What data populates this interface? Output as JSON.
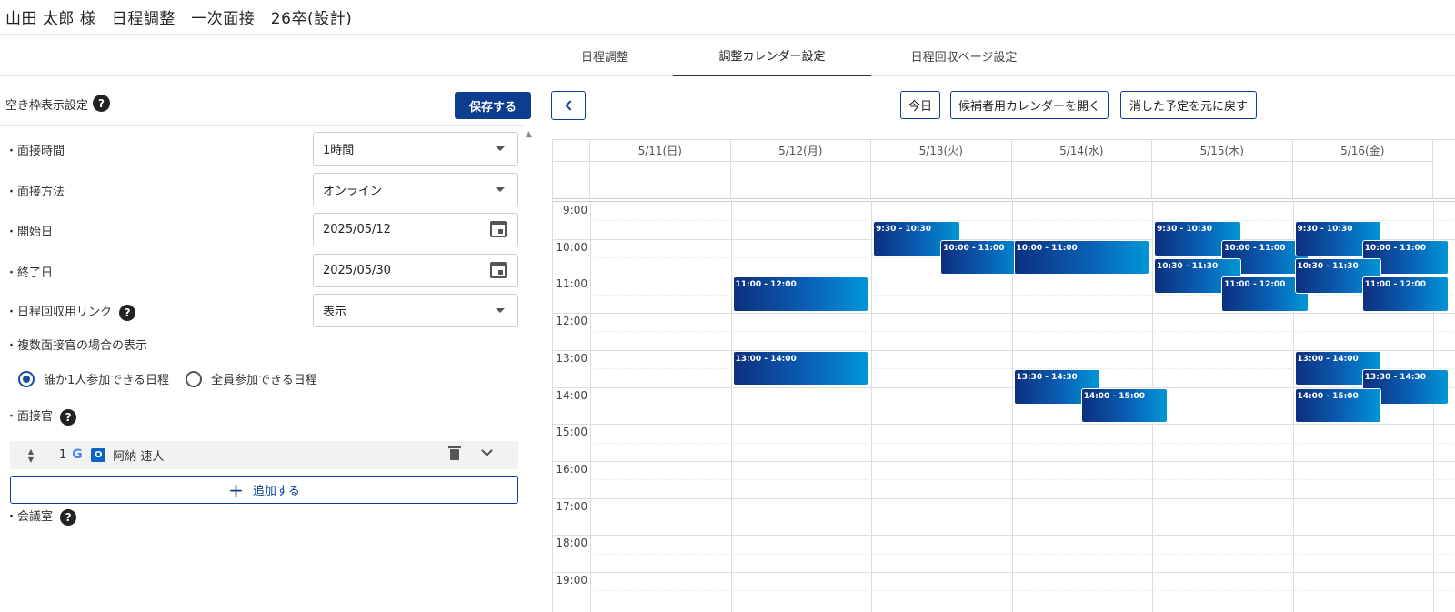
{
  "header": {
    "title": "山田 太郎 様　日程調整　一次面接　26卒(設計)"
  },
  "tabs": [
    {
      "label": "日程調整",
      "active": false
    },
    {
      "label": "調整カレンダー設定",
      "active": true
    },
    {
      "label": "日程回収ページ設定",
      "active": false
    }
  ],
  "left": {
    "section_title": "空き枠表示設定",
    "help_glyph": "?",
    "save_label": "保存する",
    "fields": [
      {
        "label": "・面接時間",
        "value": "1時間",
        "kind": "select"
      },
      {
        "label": "・面接方法",
        "value": "オンライン",
        "kind": "select"
      },
      {
        "label": "・開始日",
        "value": "2025/05/12",
        "kind": "date"
      },
      {
        "label": "・終了日",
        "value": "2025/05/30",
        "kind": "date"
      },
      {
        "label": "・日程回収用リンク",
        "value": "表示",
        "kind": "select",
        "help": true
      }
    ],
    "multi_label": "・複数面接官の場合の表示",
    "radio_options": [
      {
        "label": "誰か1人参加できる日程",
        "selected": true
      },
      {
        "label": "全員参加できる日程",
        "selected": false
      }
    ],
    "interviewer_label": "・面接官",
    "interviewers": [
      {
        "index": "1",
        "name": "阿納 速人",
        "google_glyph": "G",
        "outlook_glyph": "O"
      }
    ],
    "add_label": "追加する",
    "room_label": "・会議室"
  },
  "toolbar": {
    "today_label": "今日",
    "open_candidate_label": "候補者用カレンダーを開く",
    "restore_label": "消した予定を元に戻す"
  },
  "calendar": {
    "days": [
      "5/11(日)",
      "5/12(月)",
      "5/13(火)",
      "5/14(水)",
      "5/15(木)",
      "5/16(金)"
    ],
    "hours": [
      "9:00",
      "10:00",
      "11:00",
      "12:00",
      "13:00",
      "14:00",
      "15:00",
      "16:00",
      "17:00",
      "18:00",
      "19:00"
    ],
    "events": [
      {
        "day": 1,
        "start": 11,
        "end": 12,
        "label": "11:00 - 12:00",
        "lane": 0,
        "lanes": 1
      },
      {
        "day": 1,
        "start": 13,
        "end": 14,
        "label": "13:00 - 14:00",
        "lane": 0,
        "lanes": 1
      },
      {
        "day": 2,
        "start": 9.5,
        "end": 10.5,
        "label": "9:30 - 10:30",
        "lane": 0,
        "lanes": 2
      },
      {
        "day": 2,
        "start": 10,
        "end": 11,
        "label": "10:00 - 11:00",
        "lane": 1,
        "lanes": 2
      },
      {
        "day": 3,
        "start": 10,
        "end": 11,
        "label": "10:00 - 11:00",
        "lane": 0,
        "lanes": 1
      },
      {
        "day": 3,
        "start": 13.5,
        "end": 14.5,
        "label": "13:30 - 14:30",
        "lane": 0,
        "lanes": 2
      },
      {
        "day": 3,
        "start": 14,
        "end": 15,
        "label": "14:00 - 15:00",
        "lane": 1,
        "lanes": 2
      },
      {
        "day": 4,
        "start": 9.5,
        "end": 10.5,
        "label": "9:30 - 10:30",
        "lane": 0,
        "lanes": 2
      },
      {
        "day": 4,
        "start": 10,
        "end": 11,
        "label": "10:00 - 11:00",
        "lane": 1,
        "lanes": 2
      },
      {
        "day": 4,
        "start": 10.5,
        "end": 11.5,
        "label": "10:30 - 11:30",
        "lane": 0,
        "lanes": 2
      },
      {
        "day": 4,
        "start": 11,
        "end": 12,
        "label": "11:00 - 12:00",
        "lane": 1,
        "lanes": 2
      },
      {
        "day": 5,
        "start": 9.5,
        "end": 10.5,
        "label": "9:30 - 10:30",
        "lane": 0,
        "lanes": 2
      },
      {
        "day": 5,
        "start": 10,
        "end": 11,
        "label": "10:00 - 11:00",
        "lane": 1,
        "lanes": 2
      },
      {
        "day": 5,
        "start": 10.5,
        "end": 11.5,
        "label": "10:30 - 11:30",
        "lane": 0,
        "lanes": 2
      },
      {
        "day": 5,
        "start": 11,
        "end": 12,
        "label": "11:00 - 12:00",
        "lane": 1,
        "lanes": 2
      },
      {
        "day": 5,
        "start": 13,
        "end": 14,
        "label": "13:00 - 14:00",
        "lane": 0,
        "lanes": 2
      },
      {
        "day": 5,
        "start": 13.5,
        "end": 14.5,
        "label": "13:30 - 14:30",
        "lane": 1,
        "lanes": 2
      },
      {
        "day": 5,
        "start": 14,
        "end": 15,
        "label": "14:00 - 15:00",
        "lane": 0,
        "lanes": 2
      }
    ]
  },
  "colors": {
    "primary": "#0d3d91",
    "event_start": "#0d2f7e",
    "event_end": "#0096d6"
  }
}
